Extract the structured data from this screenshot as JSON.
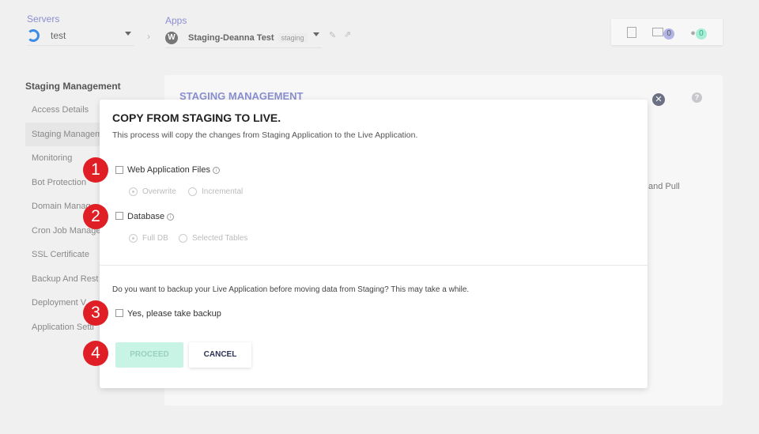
{
  "header": {
    "servers_label": "Servers",
    "server_name": "test",
    "apps_label": "Apps",
    "app_name": "Staging-Deanna Test",
    "app_tag": "staging",
    "badges": {
      "files": "0",
      "users": "0"
    }
  },
  "sidebar": {
    "title": "Staging Management",
    "items": [
      "Access Details",
      "Staging Managem",
      "Monitoring",
      "Bot Protection",
      "Domain Manag",
      "Cron Job Manage",
      "SSL Certificate",
      "Backup And Rest",
      "Deployment V",
      "Application Setti"
    ]
  },
  "panel": {
    "title": "STAGING MANAGEMENT",
    "partial_text": "and Pull"
  },
  "modal": {
    "title": "COPY FROM STAGING TO LIVE.",
    "subtitle": "This process will copy the changes from Staging Application to the Live Application.",
    "web_files": {
      "label": "Web Application Files",
      "options": [
        "Overwrite",
        "Incremental"
      ]
    },
    "database": {
      "label": "Database",
      "options": [
        "Full DB",
        "Selected Tables"
      ]
    },
    "backup_question": "Do you want to backup your Live Application before moving data from Staging? This may take a while.",
    "backup_label": "Yes, please take backup",
    "proceed": "PROCEED",
    "cancel": "CANCEL"
  },
  "steps": [
    "1",
    "2",
    "3",
    "4"
  ],
  "colors": {
    "accent": "#8a8fd0",
    "proceed": "#c8f4e6",
    "step": "#e01e26"
  }
}
